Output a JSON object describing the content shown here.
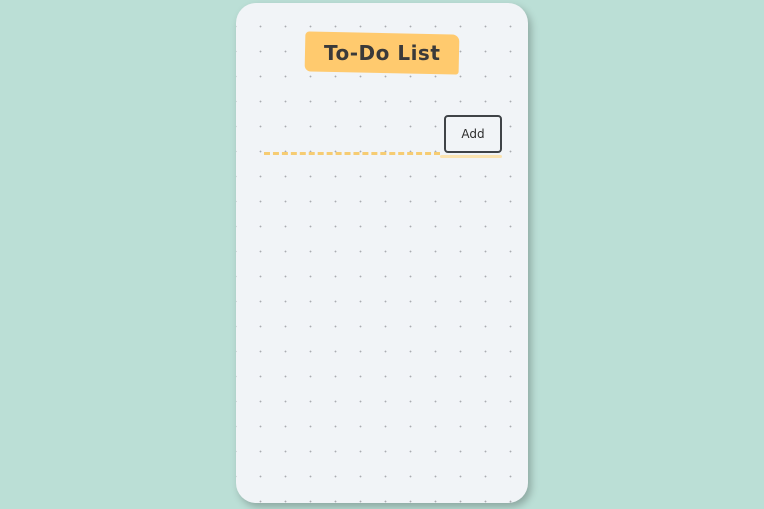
{
  "app": {
    "title": "To-Do List"
  },
  "form": {
    "input_value": "",
    "input_placeholder": "",
    "add_label": "Add"
  },
  "tasks": [],
  "colors": {
    "background": "#bbdfd6",
    "card": "#f1f4f7",
    "title_highlight": "#ffca6e",
    "input_underline": "#f6cc73",
    "button_border": "#3f4347"
  }
}
